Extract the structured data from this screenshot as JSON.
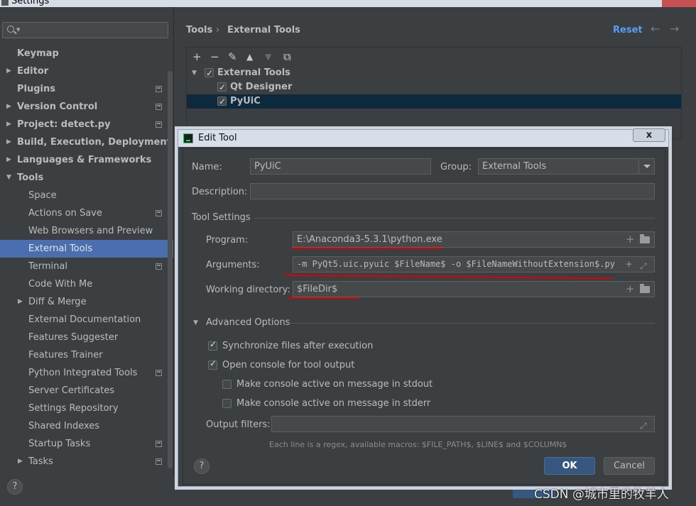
{
  "window": {
    "title": "Settings"
  },
  "sidebar": {
    "search_placeholder": "",
    "items": [
      {
        "label": "Keymap"
      },
      {
        "label": "Editor"
      },
      {
        "label": "Plugins"
      },
      {
        "label": "Version Control"
      },
      {
        "label": "Project: detect.py"
      },
      {
        "label": "Build, Execution, Deployment"
      },
      {
        "label": "Languages & Frameworks"
      },
      {
        "label": "Tools"
      },
      {
        "label": "Space"
      },
      {
        "label": "Actions on Save"
      },
      {
        "label": "Web Browsers and Preview"
      },
      {
        "label": "External Tools"
      },
      {
        "label": "Terminal"
      },
      {
        "label": "Code With Me"
      },
      {
        "label": "Diff & Merge"
      },
      {
        "label": "External Documentation"
      },
      {
        "label": "Features Suggester"
      },
      {
        "label": "Features Trainer"
      },
      {
        "label": "Python Integrated Tools"
      },
      {
        "label": "Server Certificates"
      },
      {
        "label": "Settings Repository"
      },
      {
        "label": "Shared Indexes"
      },
      {
        "label": "Startup Tasks"
      },
      {
        "label": "Tasks"
      }
    ],
    "help_label": "?"
  },
  "header": {
    "breadcrumb_root": "Tools",
    "breadcrumb_sep": "›",
    "breadcrumb_current": "External Tools",
    "reset_label": "Reset",
    "back_glyph": "←",
    "forward_glyph": "→"
  },
  "tools_tree": {
    "toolbar": [
      "+",
      "−",
      "✎",
      "▲",
      "▼",
      "⧉"
    ],
    "group": "External Tools",
    "children": [
      "Qt Designer",
      "PyUiC"
    ]
  },
  "dialog": {
    "title": "Edit Tool",
    "close_label": "x",
    "name_label": "Name:",
    "name_value": "PyUiC",
    "group_label": "Group:",
    "group_value": "External Tools",
    "description_label": "Description:",
    "description_value": "",
    "tool_settings_label": "Tool Settings",
    "program_label": "Program:",
    "program_value": "E:\\Anaconda3-5.3.1\\python.exe",
    "arguments_label": "Arguments:",
    "arguments_value": "-m PyQt5.uic.pyuic $FileName$ -o $FileNameWithoutExtension$.py",
    "working_dir_label": "Working directory:",
    "working_dir_value": "$FileDir$",
    "advanced_label": "Advanced Options",
    "options": [
      {
        "label": "Synchronize files after execution",
        "checked": true
      },
      {
        "label": "Open console for tool output",
        "checked": true
      },
      {
        "label": "Make console active on message in stdout",
        "checked": false
      },
      {
        "label": "Make console active on message in stderr",
        "checked": false
      }
    ],
    "output_filters_label": "Output filters:",
    "output_filters_value": "",
    "hint": "Each line is a regex, available macros: $FILE_PATH$, $LINE$ and $COLUMN$",
    "help_label": "?",
    "ok_label": "OK",
    "cancel_label": "Cancel"
  },
  "watermark": "CSDN @城市里的牧羊人",
  "colors": {
    "selection": "#4b6eaf",
    "accent_link": "#589df6",
    "annotation_red": "#e00000"
  }
}
